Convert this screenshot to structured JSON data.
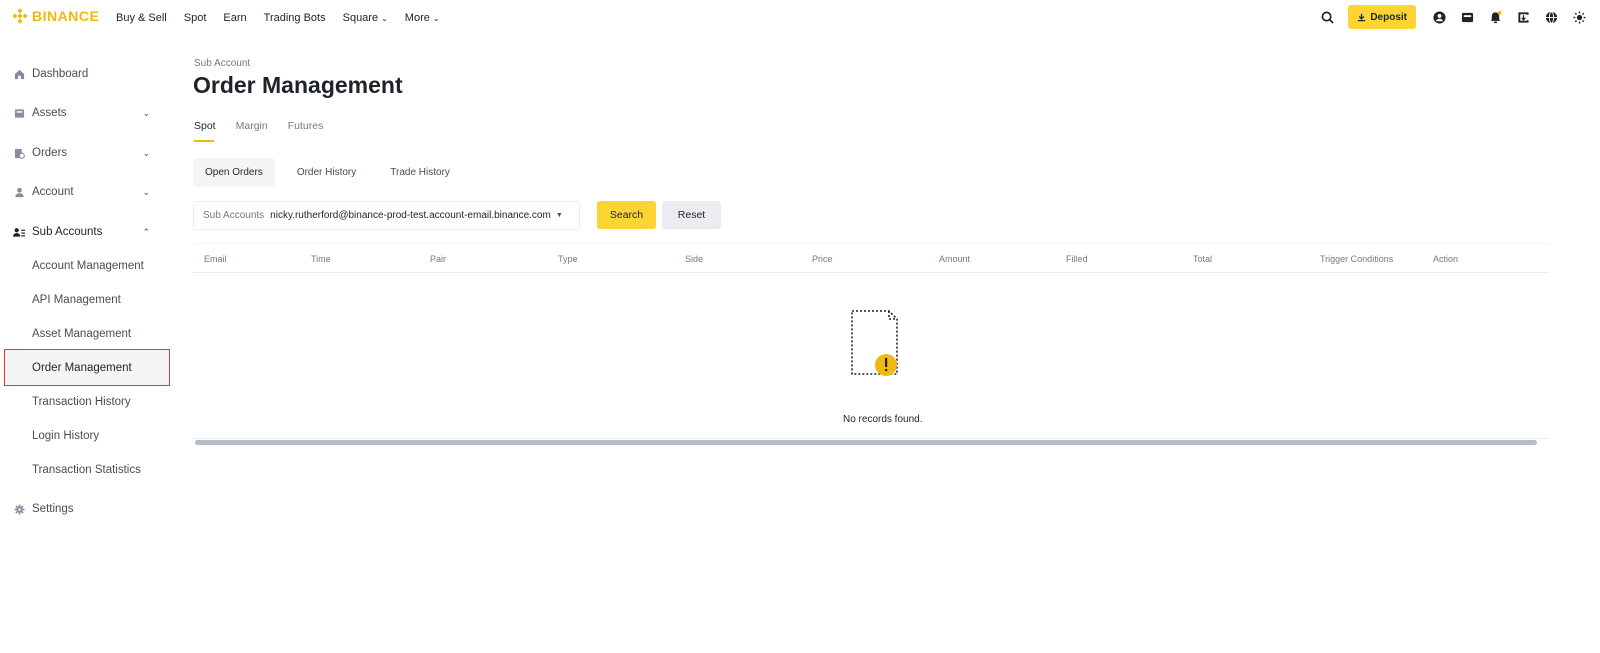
{
  "brand": {
    "name": "BINANCE",
    "color": "#f0b90b"
  },
  "nav": {
    "links": [
      {
        "label": "Buy & Sell",
        "dropdown": false
      },
      {
        "label": "Spot",
        "dropdown": false
      },
      {
        "label": "Earn",
        "dropdown": false
      },
      {
        "label": "Trading Bots",
        "dropdown": false
      },
      {
        "label": "Square",
        "dropdown": true
      },
      {
        "label": "More",
        "dropdown": true
      }
    ],
    "deposit_label": "Deposit",
    "icons": [
      "search-icon",
      "download-icon",
      "profile-icon",
      "wallet-icon",
      "bell-icon",
      "download-app-icon",
      "globe-icon",
      "theme-icon"
    ]
  },
  "sidebar": {
    "items": [
      {
        "label": "Dashboard",
        "icon": "home-icon"
      },
      {
        "label": "Assets",
        "icon": "wallet-icon",
        "expanded": false
      },
      {
        "label": "Orders",
        "icon": "orders-icon",
        "expanded": false
      },
      {
        "label": "Account",
        "icon": "user-icon",
        "expanded": false
      },
      {
        "label": "Sub Accounts",
        "icon": "sub-accounts-icon",
        "expanded": true
      },
      {
        "label": "Settings",
        "icon": "gear-icon"
      }
    ],
    "sub_items": [
      {
        "label": "Account Management"
      },
      {
        "label": "API Management"
      },
      {
        "label": "Asset Management"
      },
      {
        "label": "Order Management",
        "active": true
      },
      {
        "label": "Transaction History"
      },
      {
        "label": "Login History"
      },
      {
        "label": "Transaction Statistics"
      }
    ]
  },
  "main": {
    "breadcrumb": "Sub Account",
    "title": "Order Management",
    "tabs": [
      {
        "label": "Spot",
        "active": true
      },
      {
        "label": "Margin"
      },
      {
        "label": "Futures"
      }
    ],
    "segments": [
      {
        "label": "Open Orders",
        "active": true
      },
      {
        "label": "Order History"
      },
      {
        "label": "Trade History"
      }
    ],
    "filter": {
      "label": "Sub Accounts",
      "value": "nicky.rutherford@binance-prod-test.account-email.binance.com"
    },
    "search_label": "Search",
    "reset_label": "Reset",
    "columns": [
      "Email",
      "Time",
      "Pair",
      "Type",
      "Side",
      "Price",
      "Amount",
      "Filled",
      "Total",
      "Trigger Conditions",
      "Action"
    ],
    "empty_text": "No records found."
  },
  "colors": {
    "accent": "#fcd535",
    "highlight_border": "#e53935"
  }
}
